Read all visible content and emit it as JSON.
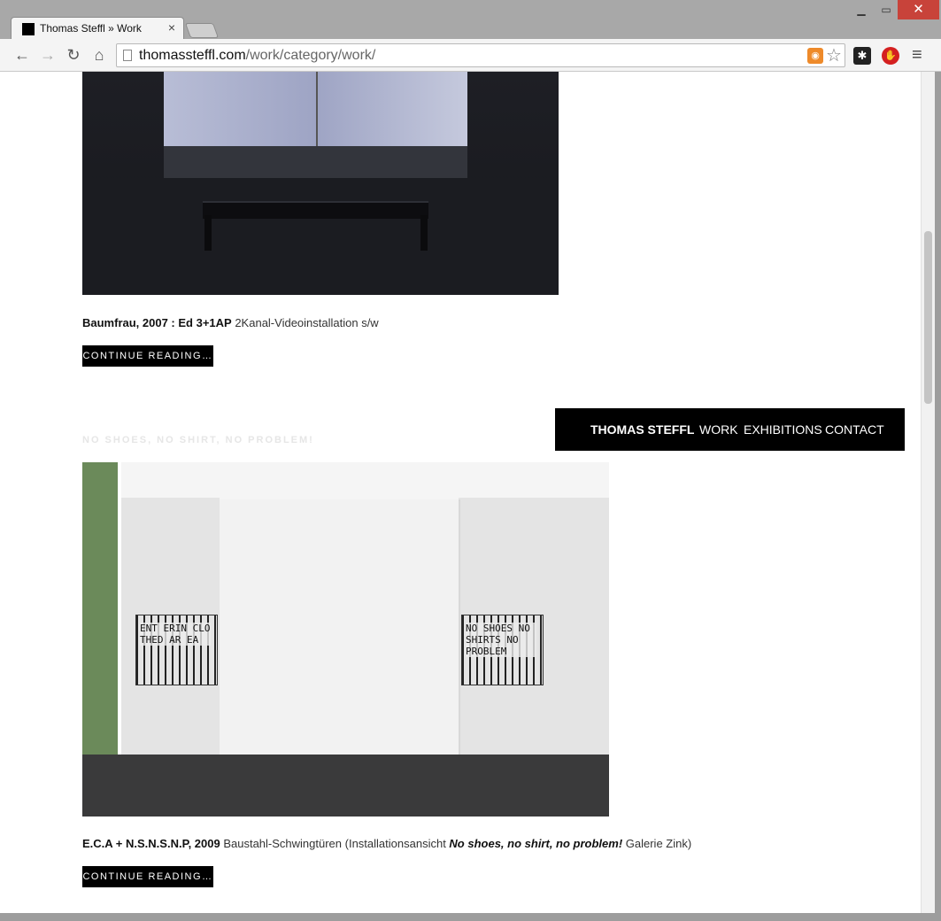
{
  "browser": {
    "tab_title": "Thomas Steffl » Work",
    "tab_close": "×",
    "url_host": "thomassteffl.com",
    "url_path": "/work/category/work/",
    "icons": [
      "back-icon",
      "forward-icon",
      "reload-icon",
      "home-icon",
      "page-icon",
      "rss-icon",
      "star-icon",
      "extension-icon",
      "adblock-icon",
      "menu-icon"
    ]
  },
  "site_nav": {
    "brand": "THOMAS STEFFL",
    "items": [
      "WORK",
      "EXHIBITIONS",
      "CONTACT"
    ]
  },
  "posts": [
    {
      "caption_bold": "Baumfrau, 2007 : Ed 3+1AP",
      "caption_text": " 2Kanal-Videoinstallation s/w",
      "button_label": "CONTINUE READING…"
    },
    {
      "title": "NO SHOES, NO SHIRT, NO PROBLEM!",
      "grille_left_text": "ENT ERIN CLO THED AR EA",
      "grille_right_text": "NO SHOES NO SHIRTS NO PROBLEM",
      "caption_bold": "E.C.A + N.S.N.S.N.P, 2009",
      "caption_text_1": " Baustahl-Schwingtüren (Installationsansicht ",
      "caption_italic": "No shoes, no shirt, no problem!",
      "caption_text_2": " Galerie Zink)",
      "button_label": "CONTINUE READING…"
    }
  ],
  "colors": {
    "nav_bg": "#000000",
    "button_bg": "#000000",
    "close_button": "#c8433a"
  }
}
